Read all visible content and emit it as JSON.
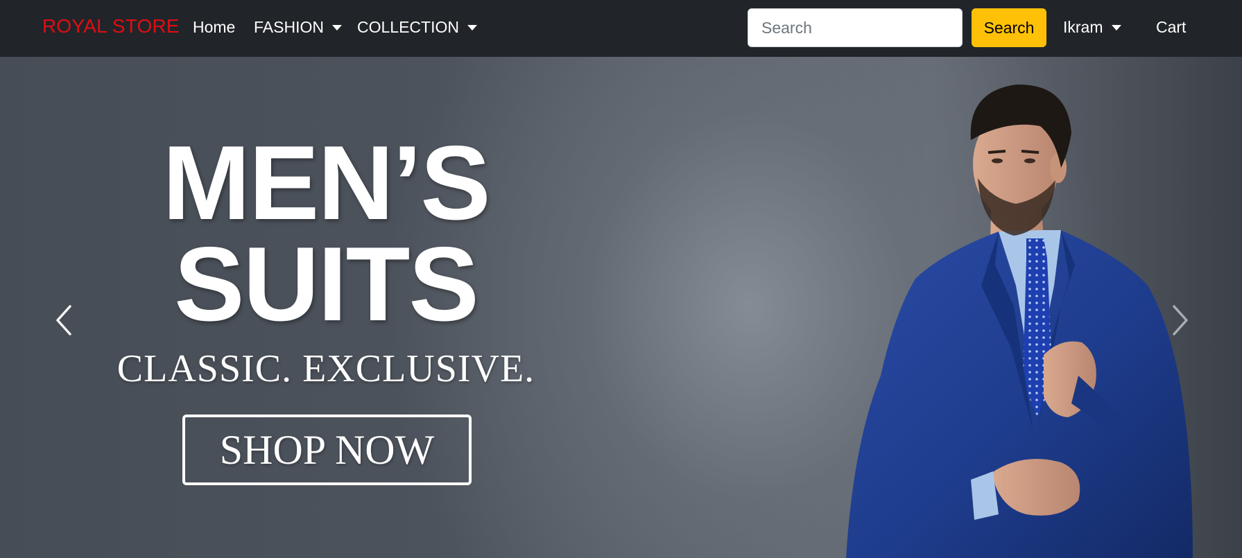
{
  "navbar": {
    "brand": "ROYAL STORE",
    "links": [
      {
        "label": "Home",
        "dropdown": false
      },
      {
        "label": "FASHION",
        "dropdown": true
      },
      {
        "label": "COLLECTION",
        "dropdown": true
      }
    ],
    "search": {
      "placeholder": "Search",
      "value": ""
    },
    "search_button": "Search",
    "user": {
      "label": "Ikram",
      "dropdown": true
    },
    "cart": "Cart"
  },
  "hero": {
    "headline_line1": "MEN’S",
    "headline_line2": "SUITS",
    "tagline": "CLASSIC. EXCLUSIVE.",
    "cta": "SHOP NOW"
  },
  "carousel": {
    "prev_icon": "chevron-left-icon",
    "next_icon": "chevron-right-icon"
  },
  "colors": {
    "navbar_bg": "#212529",
    "brand": "#e00d14",
    "search_button": "#ffc107",
    "suit": "#1e3c8c",
    "hero_bg": "#4d535c"
  }
}
